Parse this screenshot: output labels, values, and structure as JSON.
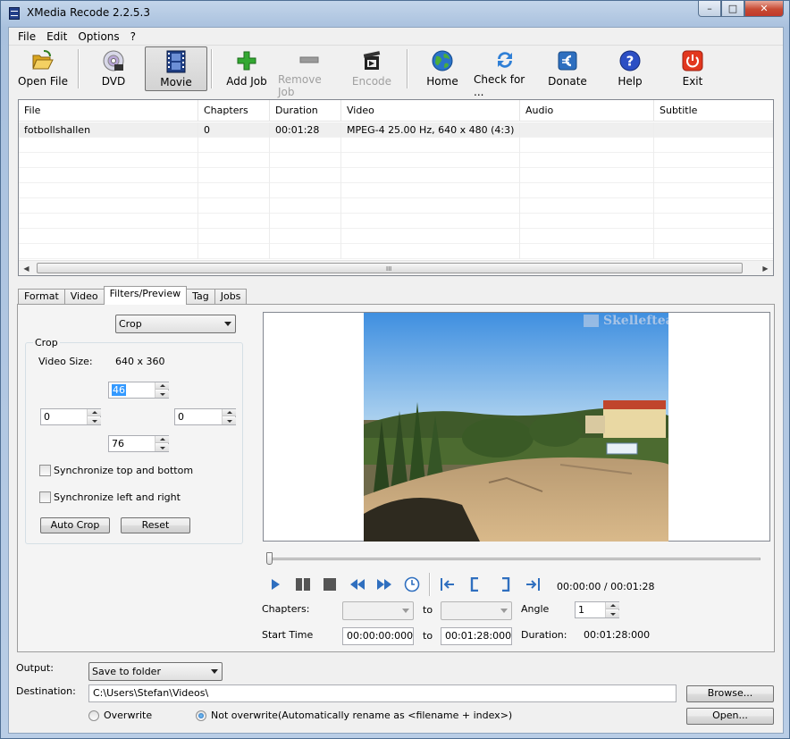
{
  "window": {
    "title": "XMedia Recode 2.2.5.3"
  },
  "window_controls": {
    "minimize": "–",
    "maximize": "□",
    "close": "✕"
  },
  "menu": [
    "File",
    "Edit",
    "Options",
    "?"
  ],
  "toolbar": {
    "open_file": "Open File",
    "dvd": "DVD",
    "movie": "Movie",
    "add_job": "Add Job",
    "remove_job": "Remove Job",
    "encode": "Encode",
    "home": "Home",
    "check_for": "Check for ...",
    "donate": "Donate",
    "help": "Help",
    "exit": "Exit"
  },
  "file_list": {
    "columns": [
      "File",
      "Chapters",
      "Duration",
      "Video",
      "Audio",
      "Subtitle"
    ],
    "rows": [
      {
        "file": "fotbollshallen",
        "chapters": "0",
        "duration": "00:01:28",
        "video": "MPEG-4 25.00 Hz, 640 x 480 (4:3)",
        "audio": "",
        "subtitle": ""
      }
    ],
    "scroll_grip": "III"
  },
  "tabs": [
    "Format",
    "Video",
    "Filters/Preview",
    "Tag",
    "Jobs"
  ],
  "active_tab": "Filters/Preview",
  "filter": {
    "selected": "Crop",
    "group_title": "Crop",
    "video_size_label": "Video Size:",
    "video_size_value": "640 x 360",
    "crop_top": "46",
    "crop_left": "0",
    "crop_right": "0",
    "crop_bottom": "76",
    "sync_top_bottom": "Synchronize top and bottom",
    "sync_left_right": "Synchronize left and right",
    "auto_crop": "Auto Crop",
    "reset": "Reset"
  },
  "preview": {
    "watermark": "Skelleftea",
    "time_display": "00:00:00 / 00:01:28",
    "position_fraction": 0.0
  },
  "chapters": {
    "label": "Chapters:",
    "to": "to",
    "angle_label": "Angle",
    "angle_value": "1"
  },
  "timing": {
    "start_label": "Start Time",
    "start_value": "00:00:00:000",
    "to": "to",
    "end_value": "00:01:28:000",
    "duration_label": "Duration:",
    "duration_value": "00:01:28:000"
  },
  "output": {
    "label": "Output:",
    "selected": "Save to folder",
    "destination_label": "Destination:",
    "destination_value": "C:\\Users\\Stefan\\Videos\\",
    "browse": "Browse...",
    "open": "Open...",
    "overwrite": "Overwrite",
    "not_overwrite": "Not overwrite(Automatically rename as <filename + index>)"
  },
  "colors": {
    "accent_blue": "#2f6fbf",
    "selection": "#3399ff",
    "exit_red": "#e2371e",
    "add_green": "#33a832"
  }
}
